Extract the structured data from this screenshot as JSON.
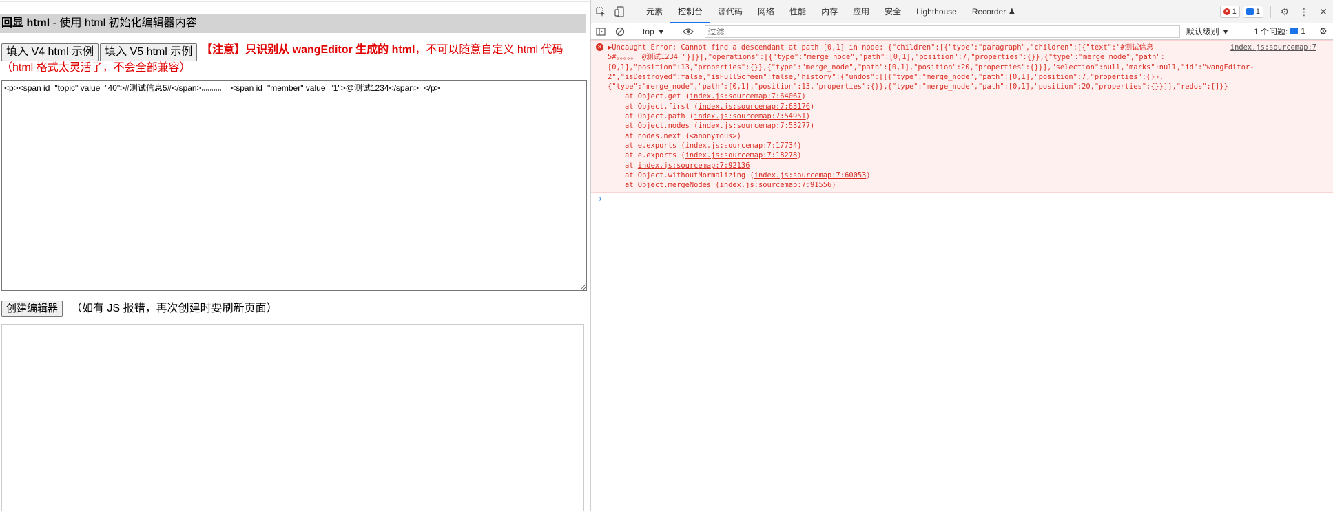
{
  "page": {
    "title_bold": "回显 html",
    "title_rest": " - 使用 html 初始化编辑器内容",
    "btn_v4": "填入 V4 html 示例",
    "btn_v5": "填入 V5 html 示例",
    "notice_bold": "【注意】只识别从 wangEditor 生成的 html",
    "notice_rest": "，不可以随意自定义 html 代码（html 格式太灵活了，不会全部兼容）",
    "textarea_value": "<p><span id=\"topic\" value=\"40\">#测试信息5#</span>。。。。。  <span id=\"member\" value=\"1\">@测试1234</span>  </p>",
    "create_btn": "创建编辑器",
    "create_hint": "（如有 JS 报错，再次创建时要刷新页面）"
  },
  "devtools": {
    "tabs": [
      "元素",
      "控制台",
      "源代码",
      "网络",
      "性能",
      "内存",
      "应用",
      "安全",
      "Lighthouse",
      "Recorder ♟"
    ],
    "active_tab": "控制台",
    "error_count": "1",
    "message_count": "1",
    "context": "top",
    "filter_placeholder": "过滤",
    "levels": "默认级别 ▼",
    "issues_label": "1 个问题:",
    "issues_count": "1",
    "error_source": "index.js:sourcemap:7",
    "error_lines": [
      "▶Uncaught Error: Cannot find a descendant at path [0,1] in node: {\"children\":[{\"type\":\"paragraph\",\"children\":[{\"text\":\"#测试信息",
      "5#。。。。。 @测试1234 \"}]}],\"operations\":[{\"type\":\"merge_node\",\"path\":[0,1],\"position\":7,\"properties\":{}},{\"type\":\"merge_node\",\"path\":",
      "[0,1],\"position\":13,\"properties\":{}},{\"type\":\"merge_node\",\"path\":[0,1],\"position\":20,\"properties\":{}}],\"selection\":null,\"marks\":null,\"id\":\"wangEditor-",
      "2\",\"isDestroyed\":false,\"isFullScreen\":false,\"history\":{\"undos\":[[{\"type\":\"merge_node\",\"path\":[0,1],\"position\":7,\"properties\":{}},",
      "{\"type\":\"merge_node\",\"path\":[0,1],\"position\":13,\"properties\":{}},{\"type\":\"merge_node\",\"path\":[0,1],\"position\":20,\"properties\":{}}]],\"redos\":[]}}"
    ],
    "stack": [
      {
        "prefix": "    at Object.get (",
        "link": "index.js:sourcemap:7:64067",
        "suffix": ")"
      },
      {
        "prefix": "    at Object.first (",
        "link": "index.js:sourcemap:7:63176",
        "suffix": ")"
      },
      {
        "prefix": "    at Object.path (",
        "link": "index.js:sourcemap:7:54951",
        "suffix": ")"
      },
      {
        "prefix": "    at Object.nodes (",
        "link": "index.js:sourcemap:7:53277",
        "suffix": ")"
      },
      {
        "prefix": "    at nodes.next (<anonymous>)",
        "link": "",
        "suffix": ""
      },
      {
        "prefix": "    at e.exports (",
        "link": "index.js:sourcemap:7:17734",
        "suffix": ")"
      },
      {
        "prefix": "    at e.exports (",
        "link": "index.js:sourcemap:7:18278",
        "suffix": ")"
      },
      {
        "prefix": "    at ",
        "link": "index.js:sourcemap:7:92136",
        "suffix": ""
      },
      {
        "prefix": "    at Object.withoutNormalizing (",
        "link": "index.js:sourcemap:7:60053",
        "suffix": ")"
      },
      {
        "prefix": "    at Object.mergeNodes (",
        "link": "index.js:sourcemap:7:91556",
        "suffix": ")"
      }
    ],
    "prompt_symbol": "›"
  }
}
